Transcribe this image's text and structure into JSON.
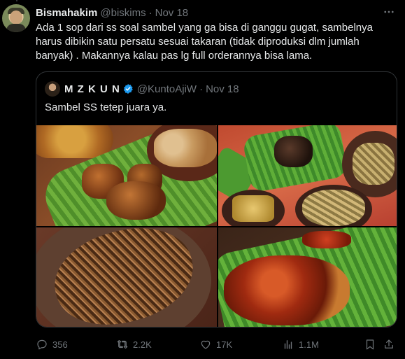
{
  "tweet": {
    "author_name": "Bismahakim",
    "author_handle": "@biskims",
    "separator": "·",
    "date": "Nov 18",
    "text": "Ada 1 sop dari ss soal sambel yang ga bisa di ganggu gugat, sambelnya harus dibikin satu persatu sesuai takaran (tidak diproduksi dlm jumlah banyak) . Makannya kalau pas lg full orderannya bisa lama.",
    "more_icon": "more-dots-icon"
  },
  "quote": {
    "author_name": "M Z K U N",
    "verified_icon": "verified-badge-icon",
    "author_handle": "@KuntoAjiW",
    "separator": "·",
    "date": "Nov 18",
    "text": "Sambel SS tetep juara ya.",
    "photos_count": 4
  },
  "actions": {
    "reply_count": "356",
    "retweet_count": "2.2K",
    "like_count": "17K",
    "view_count": "1.1M"
  },
  "colors": {
    "background": "#000000",
    "text": "#e7e9ea",
    "muted": "#71767b",
    "border": "#2f3336",
    "verified": "#1d9bf0"
  }
}
